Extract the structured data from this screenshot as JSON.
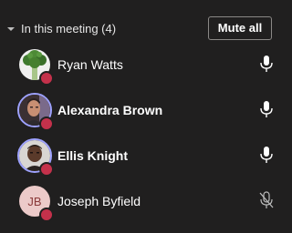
{
  "header": {
    "title": "In this meeting (4)",
    "mute_all_label": "Mute all"
  },
  "participants": [
    {
      "name": "Ryan Watts",
      "avatar": "broccoli-avatar",
      "status": "busy",
      "mic": "mic-on"
    },
    {
      "name": "Alexandra Brown",
      "avatar": "photo-avatar",
      "status": "busy",
      "mic": "mic-on",
      "highlighted": true
    },
    {
      "name": "Ellis Knight",
      "avatar": "photo-avatar",
      "status": "busy",
      "mic": "mic-on",
      "highlighted": true
    },
    {
      "name": "Joseph Byfield",
      "avatar": "initials-avatar",
      "initials": "JB",
      "status": "busy",
      "mic": "mic-off"
    }
  ],
  "colors": {
    "background": "#201f1f",
    "status_busy": "#c4314b",
    "ring": "#9ea2ff",
    "initials_bg": "#eccac9",
    "initials_text": "#8b3a3a"
  }
}
